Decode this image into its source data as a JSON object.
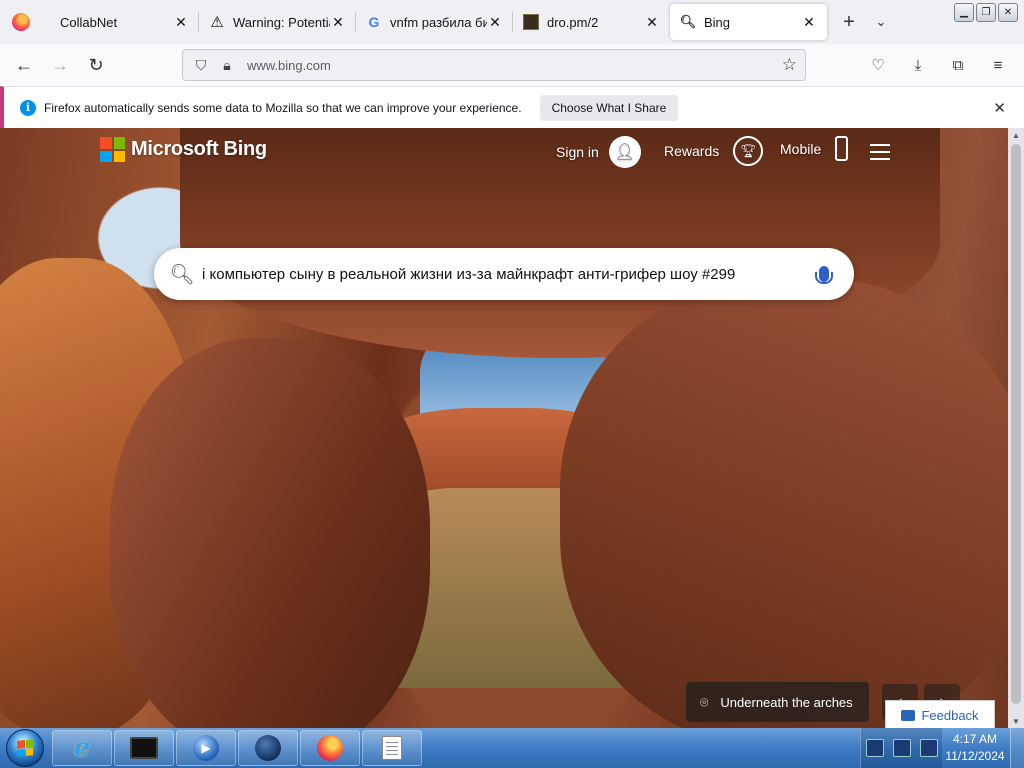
{
  "browser": {
    "tabs": [
      {
        "title": "CollabNet",
        "favicon": "blank"
      },
      {
        "title": "Warning: Potential",
        "favicon": "warning-icon"
      },
      {
        "title": "vnfm разбила би",
        "favicon": "google-icon"
      },
      {
        "title": "dro.pm/2",
        "favicon": "dro-icon"
      },
      {
        "title": "Bing",
        "favicon": "search-icon",
        "active": true
      }
    ],
    "url": "www.bing.com"
  },
  "notification": {
    "text": "Firefox automatically sends some data to Mozilla so that we can improve your experience.",
    "button": "Choose What I Share"
  },
  "bing": {
    "brand": "Microsoft Bing",
    "sign_in": "Sign in",
    "rewards": "Rewards",
    "mobile": "Mobile",
    "search_text": "і компьютер сыну в реальной жизни из-за майнкрафт анти-грифер шоу #299",
    "location": "Underneath the arches",
    "feedback": "Feedback"
  },
  "taskbar": {
    "time": "4:17 AM",
    "date": "11/12/2024"
  },
  "colors": {
    "accent": "#0090ed",
    "notice_border": "#c8397b",
    "bing_mic": "#2f5fc8"
  }
}
